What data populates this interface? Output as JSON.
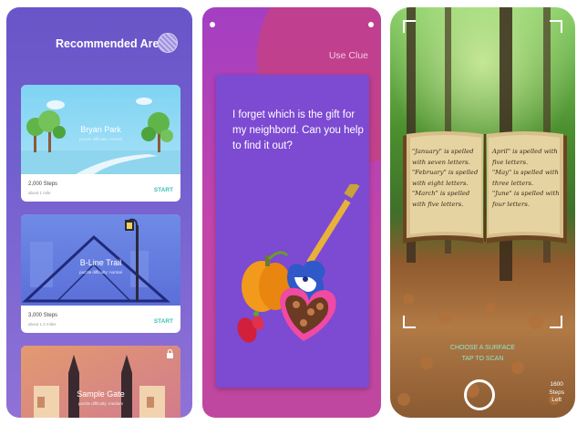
{
  "areas_screen": {
    "title": "Recommended Areas",
    "cards": [
      {
        "name": "Bryan Park",
        "difficulty": "puzzle difficulty: normal",
        "steps": "2,000 Steps",
        "distance": "about 1 mile",
        "action": "START"
      },
      {
        "name": "B-Line Trail",
        "difficulty": "puzzle difficulty: normal",
        "steps": "3,000 Steps",
        "distance": "about 1.2 miles",
        "action": "START"
      },
      {
        "name": "Sample Gate",
        "difficulty": "puzzle difficulty: medium"
      }
    ]
  },
  "clue_screen": {
    "use_clue": "Use Clue",
    "prompt": "I forget which is the gift for my neighbord. Can you help to find it out?"
  },
  "scan_screen": {
    "book_left": [
      "\"January\" is spelled",
      "with seven letters.",
      "\"February\" is spelled",
      "with eight letters.",
      "\"March\" is spelled",
      "with five letters."
    ],
    "book_right": [
      "April\" is spelled with",
      "five letters.",
      "\"May\" is spelled with",
      "three letters.",
      "\"June\" is spelled with",
      "four letters."
    ],
    "instruction_1": "CHOOSE A SURFACE",
    "instruction_2": "TAP TO SCAN",
    "steps_value": "1600",
    "steps_label_1": "Steps",
    "steps_label_2": "Left"
  },
  "colors": {
    "accent_teal": "#3cc1b4",
    "purple_bg": "#6a55c8",
    "clue_card": "#7d4ad2"
  }
}
